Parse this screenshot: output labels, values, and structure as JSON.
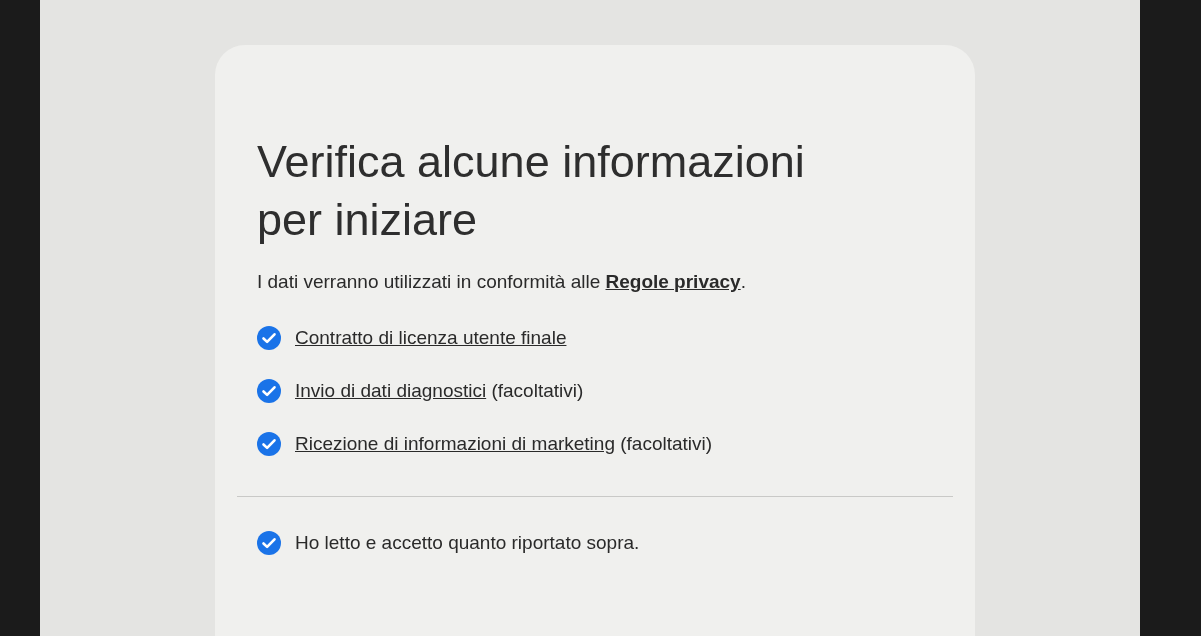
{
  "title": "Verifica alcune informazioni per iniziare",
  "intro": {
    "text": "I dati verranno utilizzati in conformità alle ",
    "link": "Regole privacy",
    "end": "."
  },
  "items": [
    {
      "link": "Contratto di licenza utente finale",
      "checked": true
    },
    {
      "link": "Invio di dati diagnostici",
      "note": "(facoltativi)",
      "checked": true
    },
    {
      "link": "Ricezione di informazioni di marketing",
      "note": "(facoltativi)",
      "checked": true
    }
  ],
  "accept": {
    "label": "Ho letto e accetto quanto riportato sopra.",
    "checked": true
  }
}
